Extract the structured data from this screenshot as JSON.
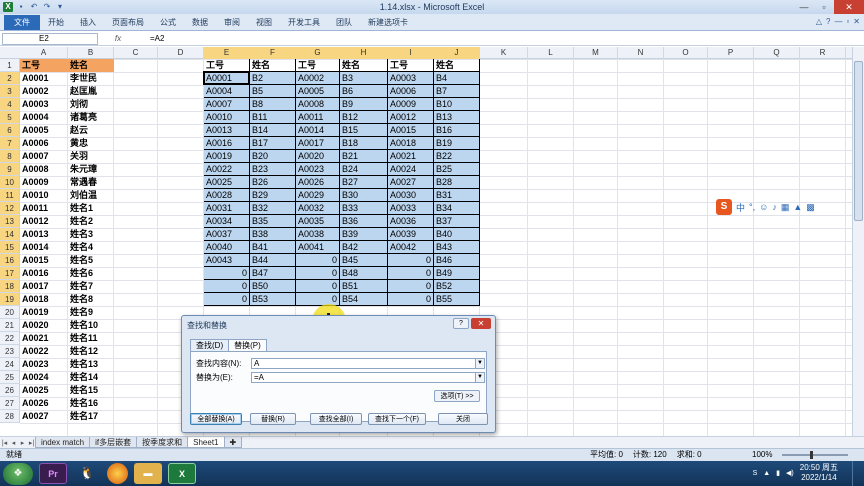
{
  "window": {
    "title": "1.14.xlsx - Microsoft Excel",
    "minimize": "—",
    "maximize": "▫",
    "close": "✕"
  },
  "ribbon": {
    "tabs": [
      "文件",
      "开始",
      "插入",
      "页面布局",
      "公式",
      "数据",
      "审阅",
      "视图",
      "开发工具",
      "团队",
      "新建选项卡"
    ]
  },
  "formula_bar": {
    "name_box": "E2",
    "fx": "fx",
    "formula": "=A2"
  },
  "grid": {
    "columns": [
      "A",
      "B",
      "C",
      "D",
      "E",
      "F",
      "G",
      "H",
      "I",
      "J",
      "K",
      "L",
      "M",
      "N",
      "O",
      "P",
      "Q",
      "R"
    ],
    "rows": [
      "1",
      "2",
      "3",
      "4",
      "5",
      "6",
      "7",
      "8",
      "9",
      "10",
      "11",
      "12",
      "13",
      "14",
      "15",
      "16",
      "17",
      "18",
      "19",
      "20",
      "21",
      "22",
      "23",
      "24",
      "25",
      "26",
      "27",
      "28"
    ],
    "header_a": "工号",
    "header_b": "姓名",
    "ids": [
      "A0001",
      "A0002",
      "A0003",
      "A0004",
      "A0005",
      "A0006",
      "A0007",
      "A0008",
      "A0009",
      "A0010",
      "A0011",
      "A0012",
      "A0013",
      "A0014",
      "A0015",
      "A0016",
      "A0017",
      "A0018",
      "A0019",
      "A0020",
      "A0021",
      "A0022",
      "A0023",
      "A0024",
      "A0025",
      "A0026",
      "A0027"
    ],
    "names": [
      "李世民",
      "赵匡胤",
      "刘彻",
      "诸葛亮",
      "赵云",
      "黄忠",
      "关羽",
      "朱元璋",
      "常遇春",
      "刘伯温",
      "姓名1",
      "姓名2",
      "姓名3",
      "姓名4",
      "姓名5",
      "姓名6",
      "姓名7",
      "姓名8",
      "姓名9",
      "姓名10",
      "姓名11",
      "姓名12",
      "姓名13",
      "姓名14",
      "姓名15",
      "姓名16",
      "姓名17"
    ],
    "block_headers": [
      "工号",
      "姓名",
      "工号",
      "姓名",
      "工号",
      "姓名"
    ],
    "block_rows": [
      [
        "A0001",
        "B2",
        "A0002",
        "B3",
        "A0003",
        "B4"
      ],
      [
        "A0004",
        "B5",
        "A0005",
        "B6",
        "A0006",
        "B7"
      ],
      [
        "A0007",
        "B8",
        "A0008",
        "B9",
        "A0009",
        "B10"
      ],
      [
        "A0010",
        "B11",
        "A0011",
        "B12",
        "A0012",
        "B13"
      ],
      [
        "A0013",
        "B14",
        "A0014",
        "B15",
        "A0015",
        "B16"
      ],
      [
        "A0016",
        "B17",
        "A0017",
        "B18",
        "A0018",
        "B19"
      ],
      [
        "A0019",
        "B20",
        "A0020",
        "B21",
        "A0021",
        "B22"
      ],
      [
        "A0022",
        "B23",
        "A0023",
        "B24",
        "A0024",
        "B25"
      ],
      [
        "A0025",
        "B26",
        "A0026",
        "B27",
        "A0027",
        "B28"
      ],
      [
        "A0028",
        "B29",
        "A0029",
        "B30",
        "A0030",
        "B31"
      ],
      [
        "A0031",
        "B32",
        "A0032",
        "B33",
        "A0033",
        "B34"
      ],
      [
        "A0034",
        "B35",
        "A0035",
        "B36",
        "A0036",
        "B37"
      ],
      [
        "A0037",
        "B38",
        "A0038",
        "B39",
        "A0039",
        "B40"
      ],
      [
        "A0040",
        "B41",
        "A0041",
        "B42",
        "A0042",
        "B43"
      ],
      [
        "A0043",
        "B44",
        "0",
        "B45",
        "0",
        "B46"
      ],
      [
        "0",
        "B47",
        "0",
        "B48",
        "0",
        "B49"
      ],
      [
        "0",
        "B50",
        "0",
        "B51",
        "0",
        "B52"
      ],
      [
        "0",
        "B53",
        "0",
        "B54",
        "0",
        "B55"
      ]
    ]
  },
  "sheet_tabs": [
    "index match",
    "if多层嵌套",
    "按季度求和",
    "Sheet1"
  ],
  "status_bar": {
    "ready": "就绪",
    "average": "平均值: 0",
    "count": "计数: 120",
    "sum": "求和: 0",
    "zoom": "100%"
  },
  "dialog": {
    "title": "查找和替换",
    "help": "?",
    "close": "✕",
    "tab_find": "查找(D)",
    "tab_replace": "替换(P)",
    "find_label": "查找内容(N):",
    "find_value": "A",
    "replace_label": "替换为(E):",
    "replace_value": "=A",
    "options_button": "选项(T) >>",
    "replace_all": "全部替换(A)",
    "replace": "替换(R)",
    "find_all": "查找全部(I)",
    "find_next": "查找下一个(F)",
    "close_button": "关闭"
  },
  "ime": {
    "logo": "S",
    "mode": "中"
  },
  "taskbar": {
    "pr": "Pr",
    "excel": "X",
    "time": "20:50 周五",
    "date": "2022/1/14"
  }
}
